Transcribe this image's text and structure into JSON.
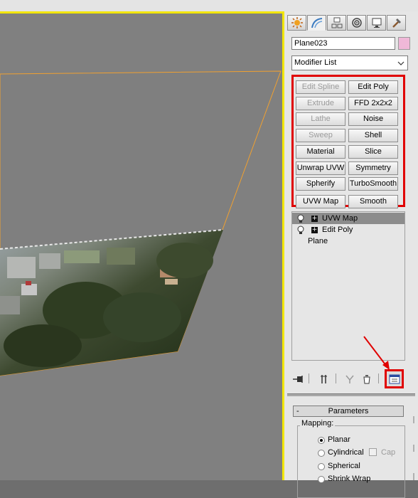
{
  "viewport": {
    "colors": {
      "background": "#808080",
      "selection_outline": "#f0a030",
      "active_border": "#f2e600"
    }
  },
  "command_panel": {
    "tabs": [
      {
        "icon": "create-icon"
      },
      {
        "icon": "modify-icon"
      },
      {
        "icon": "hierarchy-icon"
      },
      {
        "icon": "motion-icon"
      },
      {
        "icon": "display-icon"
      },
      {
        "icon": "utilities-icon"
      }
    ],
    "object_name": "Plane023",
    "object_color": "#f0b8d8",
    "modifier_list": {
      "selected": "Modifier List"
    },
    "modifier_buttons": [
      {
        "label": "Edit Spline",
        "enabled": false
      },
      {
        "label": "Edit Poly",
        "enabled": true
      },
      {
        "label": "Extrude",
        "enabled": false
      },
      {
        "label": "FFD 2x2x2",
        "enabled": true
      },
      {
        "label": "Lathe",
        "enabled": false
      },
      {
        "label": "Noise",
        "enabled": true
      },
      {
        "label": "Sweep",
        "enabled": false
      },
      {
        "label": "Shell",
        "enabled": true
      },
      {
        "label": "Material",
        "enabled": true
      },
      {
        "label": "Slice",
        "enabled": true
      },
      {
        "label": "Unwrap UVW",
        "enabled": true
      },
      {
        "label": "Symmetry",
        "enabled": true
      },
      {
        "label": "Spherify",
        "enabled": true
      },
      {
        "label": "TurboSmooth",
        "enabled": true
      },
      {
        "label": "UVW Map",
        "enabled": true
      },
      {
        "label": "Smooth",
        "enabled": true
      }
    ],
    "stack": [
      {
        "label": "UVW Map",
        "selected": true,
        "has_bulb": true,
        "expandable": true
      },
      {
        "label": "Edit Poly",
        "selected": false,
        "has_bulb": true,
        "expandable": true
      },
      {
        "label": "Plane",
        "selected": false,
        "has_bulb": false,
        "expandable": false
      }
    ],
    "stack_tools": [
      {
        "icon": "pin-stack-icon"
      },
      {
        "icon": "show-end-result-icon"
      },
      {
        "icon": "make-unique-icon"
      },
      {
        "icon": "remove-modifier-icon"
      },
      {
        "icon": "configure-modifier-sets-icon"
      }
    ],
    "parameters": {
      "rollout_title": "Parameters",
      "rollout_toggle": "-",
      "mapping_group": "Mapping:",
      "options": [
        {
          "label": "Planar",
          "checked": true
        },
        {
          "label": "Cylindrical",
          "checked": false
        },
        {
          "label": "Spherical",
          "checked": false
        },
        {
          "label": "Shrink Wrap",
          "checked": false
        }
      ],
      "cap_label": "Cap"
    }
  },
  "annotations": {
    "highlight_color": "#e00000"
  }
}
